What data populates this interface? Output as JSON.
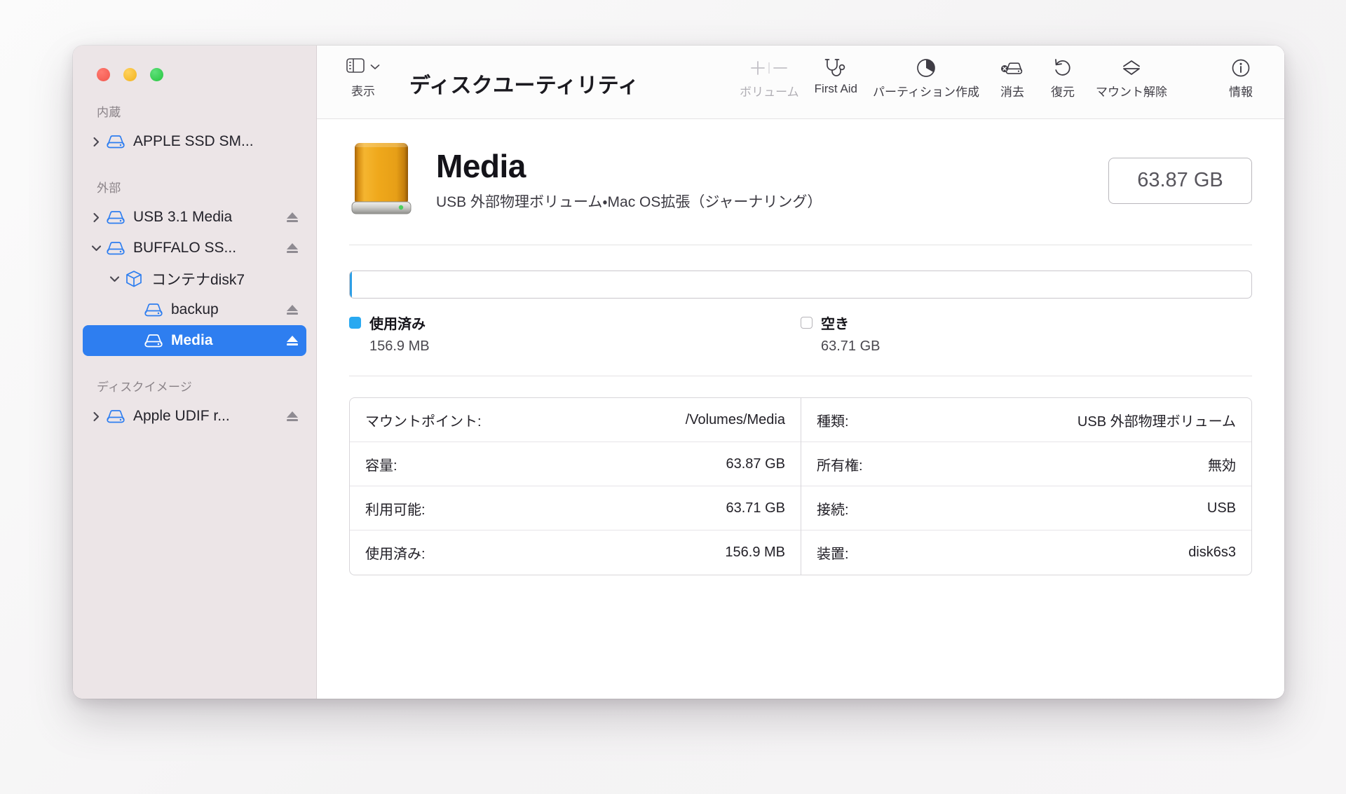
{
  "window": {
    "traffic_lights": [
      {
        "name": "close",
        "color": "#f1564c"
      },
      {
        "name": "minimize",
        "color": "#f2b21c"
      },
      {
        "name": "zoom",
        "color": "#26c53f"
      }
    ]
  },
  "app": {
    "title": "ディスクユーティリティ"
  },
  "sidebar": {
    "groups": [
      {
        "label": "内蔵",
        "items": [
          {
            "label": "APPLE SSD SM...",
            "icon": "disk-icon",
            "twisty": "right",
            "indent": 0,
            "eject": false,
            "selected": false
          }
        ]
      },
      {
        "label": "外部",
        "items": [
          {
            "label": "USB 3.1 Media",
            "icon": "disk-icon",
            "twisty": "right",
            "indent": 0,
            "eject": true,
            "selected": false
          },
          {
            "label": "BUFFALO SS...",
            "icon": "disk-icon",
            "twisty": "down",
            "indent": 0,
            "eject": true,
            "selected": false
          },
          {
            "label": "コンテナdisk7",
            "icon": "container-icon",
            "twisty": "down",
            "indent": 1,
            "eject": false,
            "selected": false
          },
          {
            "label": "backup",
            "icon": "volume-icon",
            "twisty": "none",
            "indent": 2,
            "eject": true,
            "selected": false
          },
          {
            "label": "Media",
            "icon": "volume-icon",
            "twisty": "none",
            "indent": 2,
            "eject": true,
            "selected": true
          }
        ]
      },
      {
        "label": "ディスクイメージ",
        "items": [
          {
            "label": "Apple UDIF r...",
            "icon": "disk-icon",
            "twisty": "right",
            "indent": 0,
            "eject": true,
            "selected": false
          }
        ]
      }
    ]
  },
  "toolbar": {
    "view": {
      "label": "表示",
      "icon": "sidebar-toggle-icon"
    },
    "items": [
      {
        "label": "ボリューム",
        "icon": "plus-minus-icon",
        "disabled": true
      },
      {
        "label": "First Aid",
        "icon": "stethoscope-icon",
        "disabled": false
      },
      {
        "label": "パーティション作成",
        "icon": "partition-pie-icon",
        "disabled": false
      },
      {
        "label": "消去",
        "icon": "erase-disk-icon",
        "disabled": false
      },
      {
        "label": "復元",
        "icon": "restore-arrow-icon",
        "disabled": false
      },
      {
        "label": "マウント解除",
        "icon": "unmount-eject-icon",
        "disabled": false
      },
      {
        "label": "情報",
        "icon": "info-circle-icon",
        "disabled": false
      }
    ]
  },
  "volume": {
    "name": "Media",
    "subtitle": "USB 外部物理ボリューム・Mac OS拡張（ジャーナリング）",
    "capacity_badge": "63.87 GB",
    "icon": "external-hard-drive-icon"
  },
  "usage": {
    "used_percent": 0.25,
    "legend": [
      {
        "name": "使用済み",
        "value": "156.9 MB",
        "swatch": "used",
        "color": "#29a9f1"
      },
      {
        "name": "空き",
        "value": "63.71 GB",
        "swatch": "free",
        "color": "#ffffff"
      }
    ]
  },
  "details": {
    "left": [
      {
        "key": "マウントポイント:",
        "value": "/Volumes/Media"
      },
      {
        "key": "容量:",
        "value": "63.87 GB"
      },
      {
        "key": "利用可能:",
        "value": "63.71 GB"
      },
      {
        "key": "使用済み:",
        "value": "156.9 MB"
      }
    ],
    "right": [
      {
        "key": "種類:",
        "value": "USB 外部物理ボリューム"
      },
      {
        "key": "所有権:",
        "value": "無効"
      },
      {
        "key": "接続:",
        "value": "USB"
      },
      {
        "key": "装置:",
        "value": "disk6s3"
      }
    ]
  }
}
